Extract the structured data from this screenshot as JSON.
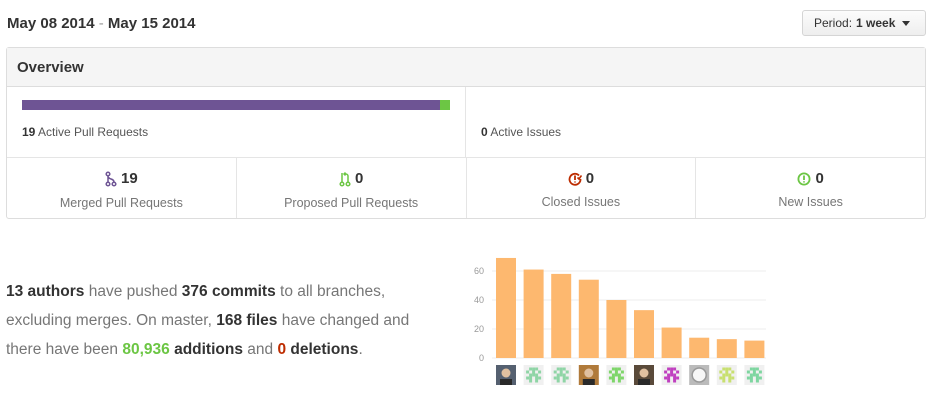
{
  "header": {
    "date_start": "May 08 2014",
    "date_sep": "-",
    "date_end": "May 15 2014",
    "period_label": "Period:",
    "period_value": "1 week"
  },
  "overview": {
    "title": "Overview",
    "pull_requests": {
      "count": "19",
      "label": "Active Pull Requests",
      "merged_share": 0.977
    },
    "issues": {
      "count": "0",
      "label": "Active Issues"
    },
    "stats": [
      {
        "value": "19",
        "label": "Merged Pull Requests",
        "icon": "git-merge-icon",
        "color": "#6e5494"
      },
      {
        "value": "0",
        "label": "Proposed Pull Requests",
        "icon": "git-pull-request-icon",
        "color": "#6cc644"
      },
      {
        "value": "0",
        "label": "Closed Issues",
        "icon": "issue-closed-icon",
        "color": "#bd2c00"
      },
      {
        "value": "0",
        "label": "New Issues",
        "icon": "issue-opened-icon",
        "color": "#6cc644"
      }
    ]
  },
  "summary": {
    "authors": "13 authors",
    "t1": " have pushed ",
    "commits": "376 commits",
    "t2": " to all branches, excluding merges. On master, ",
    "files": "168 files",
    "t3": " have changed and there have been ",
    "additions_num": "80,936",
    "additions_word": " additions",
    "t4": " and ",
    "deletions_num": "0",
    "deletions_word": " deletions",
    "t5": "."
  },
  "chart_data": {
    "type": "bar",
    "categories": [
      "author-1",
      "author-2",
      "author-3",
      "author-4",
      "author-5",
      "author-6",
      "author-7",
      "author-8",
      "author-9",
      "author-10"
    ],
    "values": [
      69,
      61,
      58,
      54,
      40,
      33,
      21,
      14,
      13,
      12
    ],
    "yticks": [
      "0",
      "20",
      "40",
      "60"
    ],
    "ylim": [
      0,
      70
    ],
    "bar_color": "#fdb86f",
    "grid": true
  },
  "avatars": [
    {
      "name": "avatar-photo-1",
      "kind": "photo",
      "color": "#556070"
    },
    {
      "name": "avatar-identicon-2",
      "kind": "identicon",
      "color": "#8fd5a6"
    },
    {
      "name": "avatar-identicon-3",
      "kind": "identicon",
      "color": "#8fd5a6"
    },
    {
      "name": "avatar-cat-4",
      "kind": "photo",
      "color": "#b07a3a"
    },
    {
      "name": "avatar-identicon-5",
      "kind": "identicon",
      "color": "#7ed66a"
    },
    {
      "name": "avatar-photo-6",
      "kind": "photo",
      "color": "#5a4a3a"
    },
    {
      "name": "avatar-identicon-7",
      "kind": "identicon",
      "color": "#c040c0"
    },
    {
      "name": "avatar-octocat-8",
      "kind": "octocat",
      "color": "#bbbbbb"
    },
    {
      "name": "avatar-identicon-9",
      "kind": "identicon",
      "color": "#c8e070"
    },
    {
      "name": "avatar-identicon-10",
      "kind": "identicon",
      "color": "#7ed6a0"
    }
  ]
}
